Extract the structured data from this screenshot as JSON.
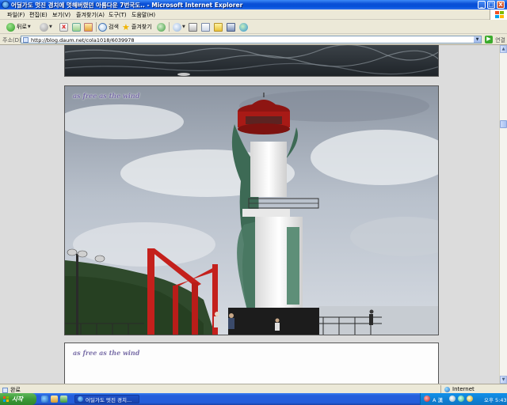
{
  "window": {
    "title": "어딜가도 멋진 경치에 멋해버렸던 아름다운 7번국도.. - Microsoft Internet Explorer",
    "minimize": "_",
    "maximize": "□",
    "close": "X"
  },
  "menu": {
    "items": [
      "파일(F)",
      "편집(E)",
      "보기(V)",
      "즐겨찾기(A)",
      "도구(T)",
      "도움말(H)"
    ]
  },
  "toolbar": {
    "back": "뒤로",
    "search": "검색",
    "favorites": "즐겨찾기"
  },
  "address": {
    "label": "주소(D)",
    "url": "http://blog.daum.net/cola1018/6039978",
    "go": "▶",
    "links": "연결"
  },
  "content": {
    "watermark": "as free as the wind",
    "watermark2": "as free as the wind"
  },
  "status": {
    "text": "완료",
    "zone": "Internet"
  },
  "taskbar": {
    "start": "시작",
    "task_title": "어딜가도 멋진 경치...",
    "clock": "오후 5:43",
    "ime": "A 漢"
  }
}
